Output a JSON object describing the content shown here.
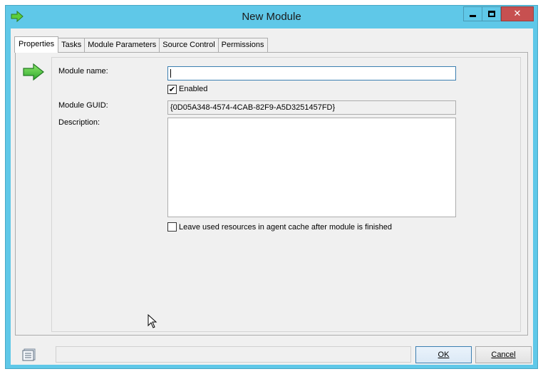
{
  "window": {
    "title": "New Module"
  },
  "tabs": [
    {
      "label": "Properties",
      "active": true
    },
    {
      "label": "Tasks",
      "active": false
    },
    {
      "label": "Module Parameters",
      "active": false
    },
    {
      "label": "Source Control",
      "active": false
    },
    {
      "label": "Permissions",
      "active": false
    }
  ],
  "form": {
    "module_name_label": "Module name:",
    "module_name_value": "",
    "enabled_label": "Enabled",
    "enabled_checked": true,
    "guid_label": "Module GUID:",
    "guid_value": "{0D05A348-4574-4CAB-82F9-A5D3251457FD}",
    "description_label": "Description:",
    "description_value": "",
    "leave_resources_label": "Leave used resources in agent cache after module is finished",
    "leave_resources_checked": false
  },
  "buttons": {
    "ok_label": "OK",
    "cancel_label": "Cancel"
  },
  "status": {
    "text": ""
  },
  "icons": {
    "title": "green-arrow-icon",
    "panel": "green-arrow-icon",
    "status": "list-view-icon"
  },
  "colors": {
    "titlebar": "#5fc8e8",
    "close_button": "#c75050",
    "arrow_green": "#3fb63f"
  }
}
